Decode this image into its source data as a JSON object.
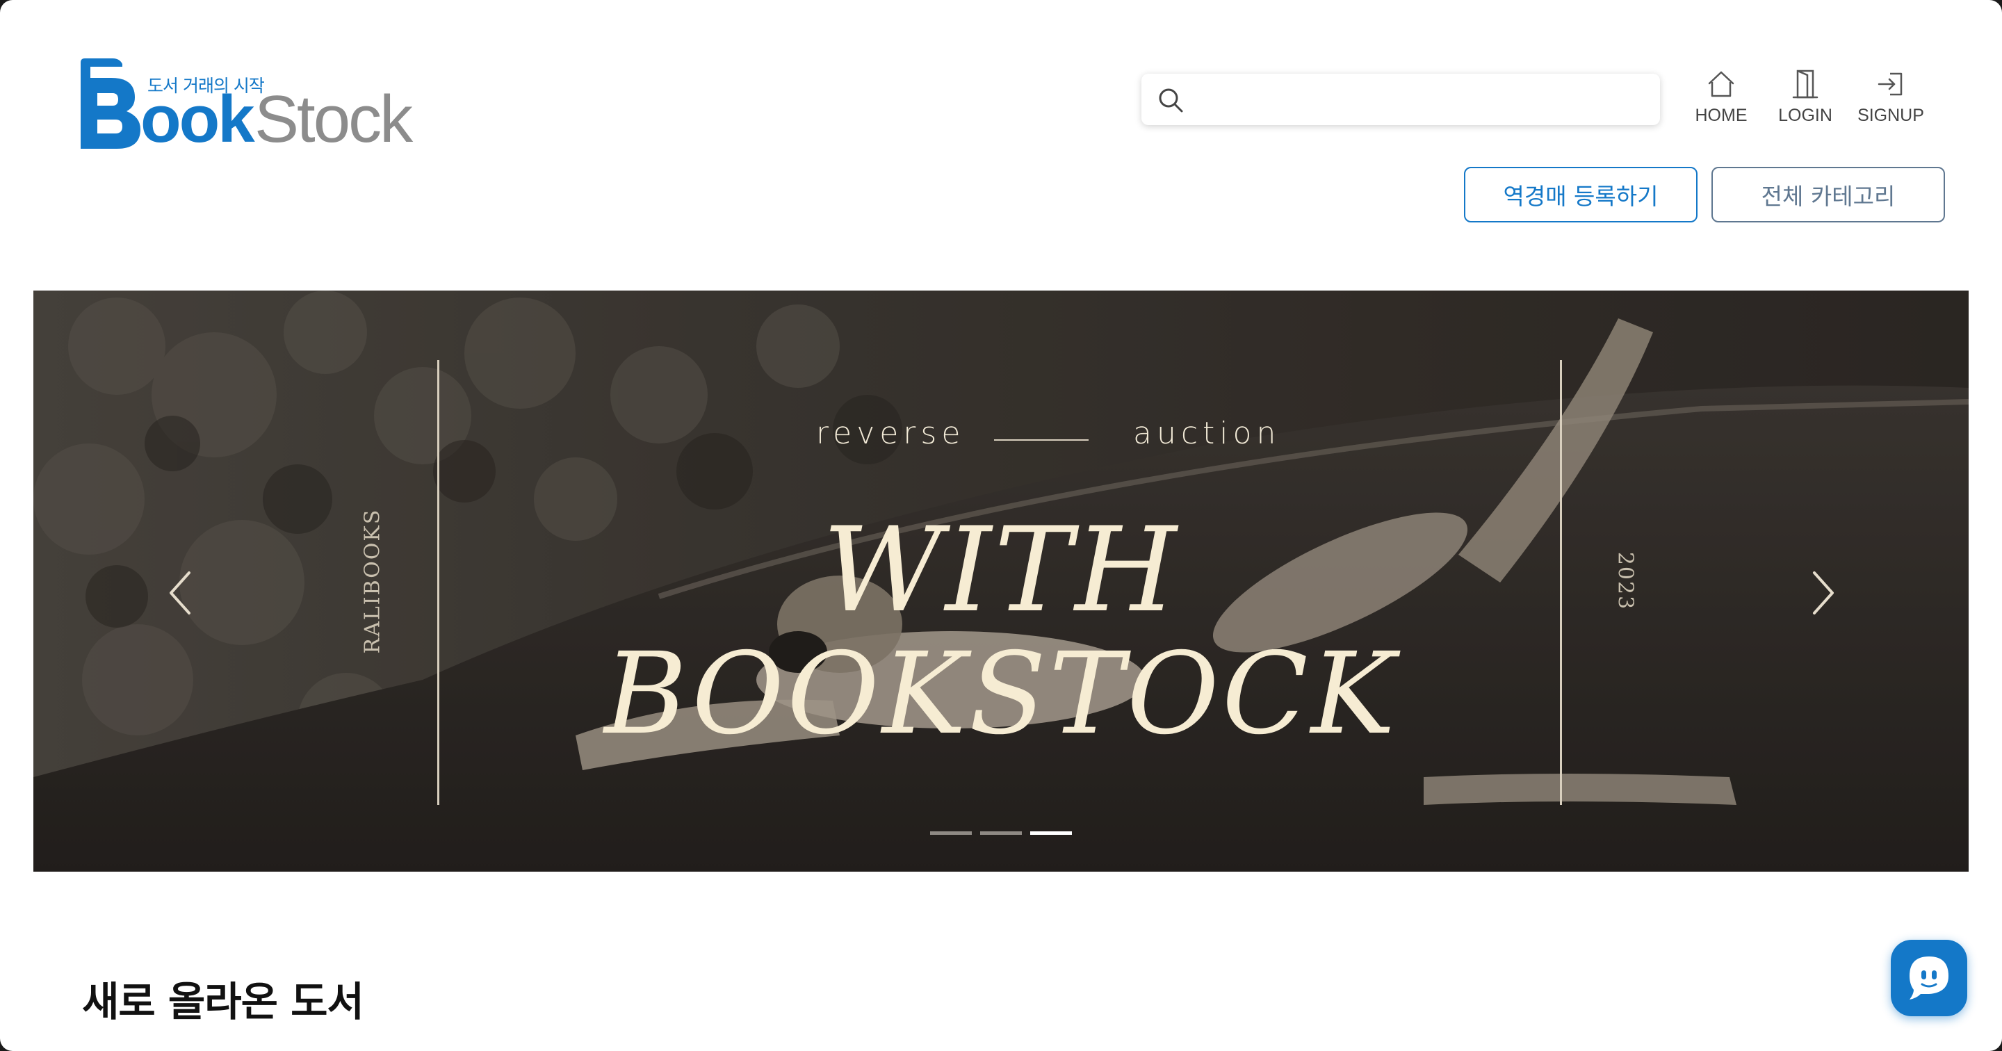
{
  "brand": {
    "tagline": "도서 거래의 시작",
    "name_part1": "ook",
    "name_part2": "Stock",
    "name_initial": "B",
    "primary_color": "#1478c8",
    "secondary_color": "#8c8c8c"
  },
  "search": {
    "placeholder": "",
    "value": "",
    "icon": "search-icon"
  },
  "nav": {
    "home": {
      "label": "HOME",
      "icon": "home-icon"
    },
    "login": {
      "label": "LOGIN",
      "icon": "door-icon"
    },
    "signup": {
      "label": "SIGNUP",
      "icon": "sign-in-icon"
    }
  },
  "actions": {
    "reverse_auction_label": "역경매 등록하기",
    "all_categories_label": "전체 카테고리"
  },
  "banner": {
    "kicker_left": "reverse",
    "kicker_right": "auction",
    "headline_line1": "WITH",
    "headline_line2": "BOOKSTOCK",
    "side_left": "RALIBOOKS",
    "side_right": "2023",
    "slide_count": 3,
    "active_slide": 3,
    "prev_icon": "chevron-left-icon",
    "next_icon": "chevron-right-icon"
  },
  "sections": {
    "new_books_title": "새로 올라온 도서"
  },
  "chat": {
    "icon": "chat-bubble-icon",
    "color": "#1478c8"
  }
}
